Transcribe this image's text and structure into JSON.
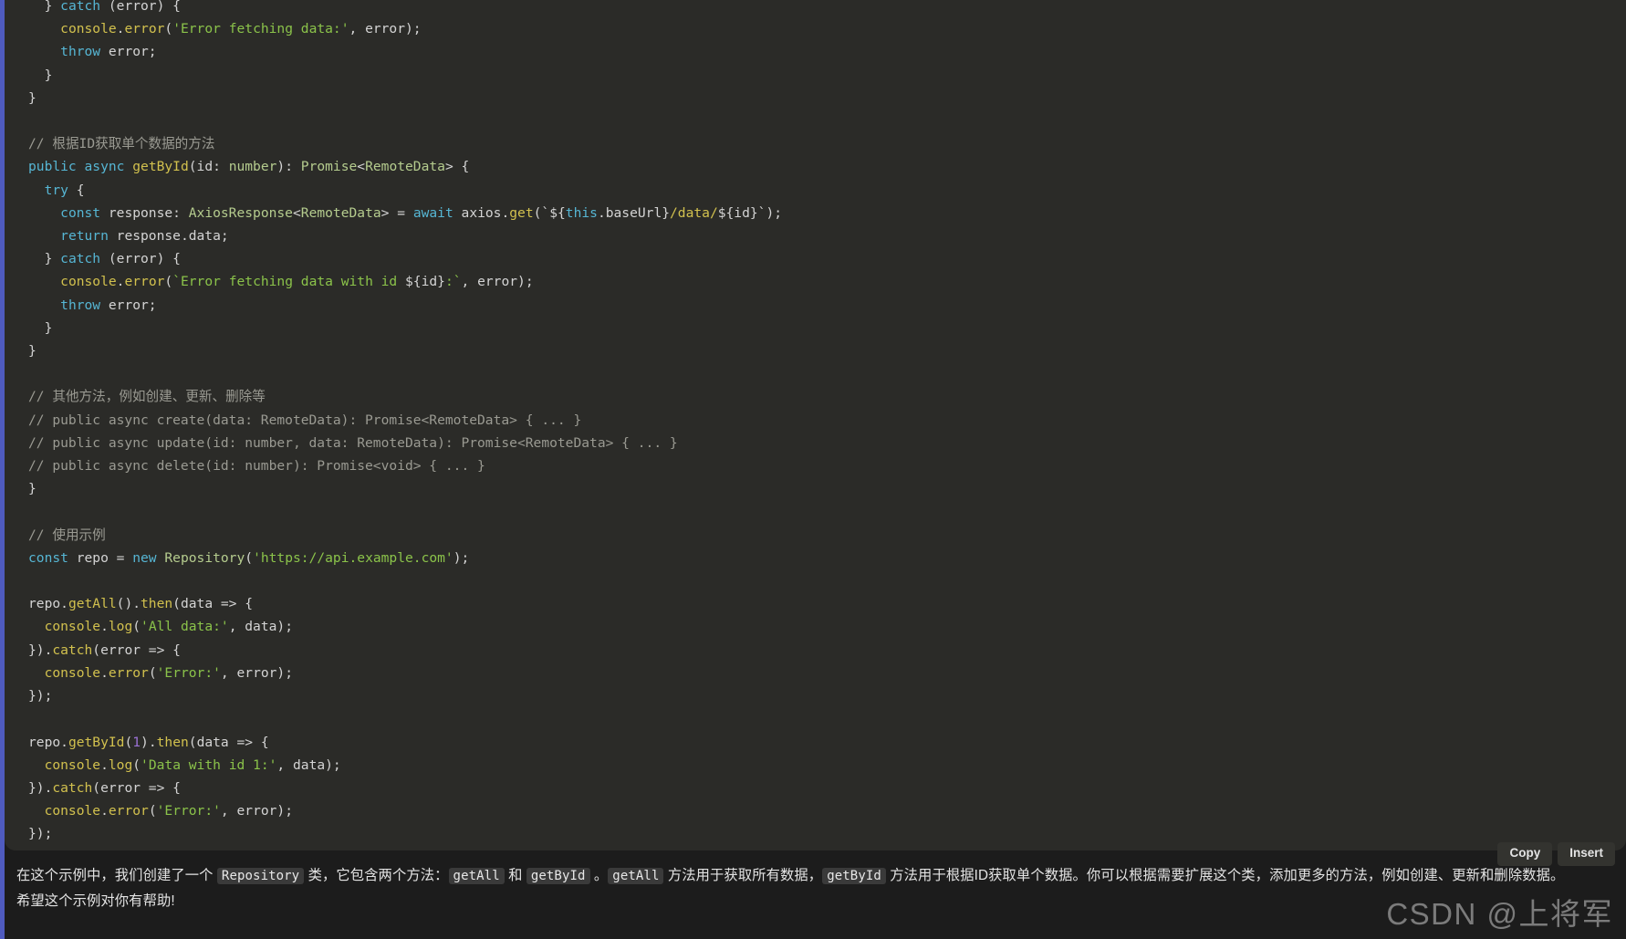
{
  "accent_color": "#4f5bbf",
  "code_block": {
    "background": "#2b2b28",
    "language": "typescript",
    "lines": [
      "  } catch (error) {",
      "    console.error('Error fetching data:', error);",
      "    throw error;",
      "  }",
      "}",
      "",
      "// 根据ID获取单个数据的方法",
      "public async getById(id: number): Promise<RemoteData> {",
      "  try {",
      "    const response: AxiosResponse<RemoteData> = await axios.get(`${this.baseUrl}/data/${id}`);",
      "    return response.data;",
      "  } catch (error) {",
      "    console.error(`Error fetching data with id ${id}:`, error);",
      "    throw error;",
      "  }",
      "}",
      "",
      "// 其他方法，例如创建、更新、删除等",
      "// public async create(data: RemoteData): Promise<RemoteData> { ... }",
      "// public async update(id: number, data: RemoteData): Promise<RemoteData> { ... }",
      "// public async delete(id: number): Promise<void> { ... }",
      "}",
      "",
      "// 使用示例",
      "const repo = new Repository('https://api.example.com');",
      "",
      "repo.getAll().then(data => {",
      "  console.log('All data:', data);",
      "}).catch(error => {",
      "  console.error('Error:', error);",
      "});",
      "",
      "repo.getById(1).then(data => {",
      "  console.log('Data with id 1:', data);",
      "}).catch(error => {",
      "  console.error('Error:', error);",
      "});"
    ]
  },
  "toolbar": {
    "copy_label": "Copy",
    "insert_label": "Insert"
  },
  "prose": {
    "line1_part1": "在这个示例中，我们创建了一个 ",
    "line1_code1": "Repository",
    "line1_part2": " 类，它包含两个方法：",
    "line1_code2": "getAll",
    "line1_part3": " 和 ",
    "line1_code3": "getById",
    "line1_part4": " 。",
    "line1_code4": "getAll",
    "line1_part5": " 方法用于获取所有数据，",
    "line1_code5": "getById",
    "line1_part6": " 方法用于根据ID获取单个数据。你可以根据需要扩展这个类，添加更多的方法，例如创建、更新和删除数据。",
    "line2": "希望这个示例对你有帮助!"
  },
  "watermark": {
    "text": "CSDN @上将军"
  }
}
